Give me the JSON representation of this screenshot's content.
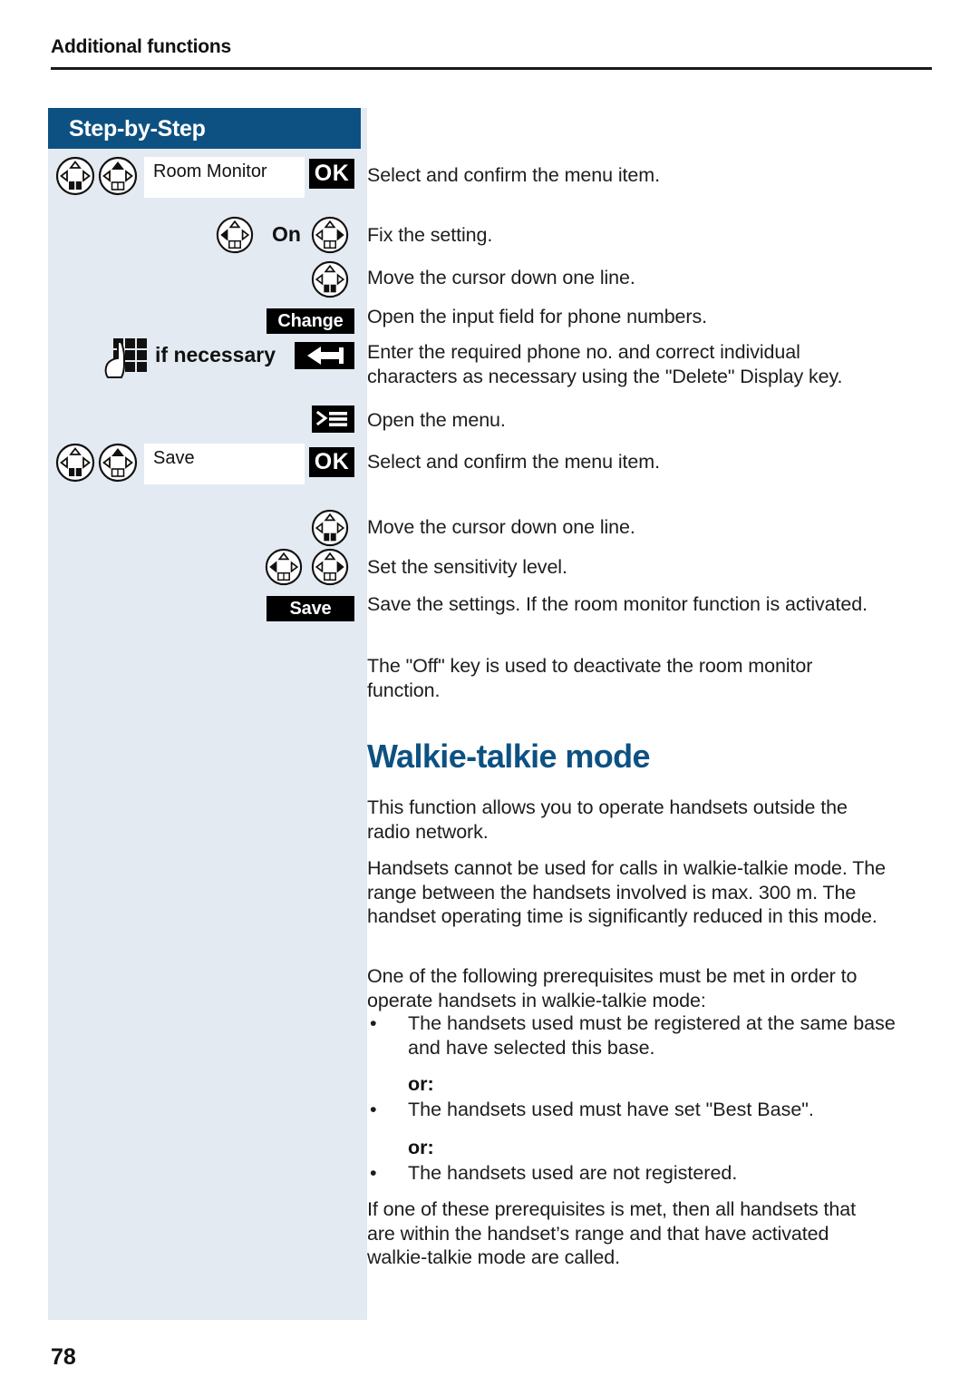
{
  "page": {
    "running_head": "Additional functions",
    "number": "78",
    "accent_color": "#0d5182",
    "panel_color": "#e4eaf1"
  },
  "step_panel": {
    "header": "Step-by-Step",
    "rows": [
      {
        "id": "room-monitor",
        "icons": [
          "nav-key-down-filled-book",
          "nav-key-up-filled"
        ],
        "display_value": "Room Monitor",
        "softkey": "OK"
      },
      {
        "id": "on-setting",
        "icons": [
          "nav-key-left-filled"
        ],
        "label": "On",
        "icons_right": [
          "nav-key-right-filled"
        ]
      },
      {
        "id": "cursor-down-1",
        "icons": [
          "nav-key-down-filled-book"
        ]
      },
      {
        "id": "open-number-field",
        "softkey": "Change"
      },
      {
        "id": "enter-number",
        "icons": [
          "keypad-hand-icon"
        ],
        "label": "if necessary",
        "softkey": "←"
      },
      {
        "id": "open-menu",
        "icons": [
          "menu-key-icon"
        ]
      },
      {
        "id": "save-menu-item",
        "icons": [
          "nav-key-down-filled-book",
          "nav-key-up-filled"
        ],
        "display_value": "Save",
        "softkey": "OK"
      },
      {
        "id": "cursor-down-2",
        "icons": [
          "nav-key-down-filled-book"
        ]
      },
      {
        "id": "sensitivity",
        "icons": [
          "nav-key-left-filled",
          "nav-key-right-filled"
        ]
      },
      {
        "id": "save-settings",
        "softkey": "Save"
      }
    ]
  },
  "instructions": [
    "Select and confirm the menu item.",
    "Fix the setting.",
    "Move the cursor down one line.",
    "Open the input field for phone numbers.",
    "Enter the required phone no. and correct individual characters as necessary using the \"Delete\" Display key.",
    "Open the menu.",
    "Select and confirm the menu item.",
    "Move the cursor down one line.",
    "Set the sensitivity level.",
    "Save the settings. If the room monitor function is activated.",
    "The \"Off\" key is used to deactivate the room monitor function."
  ],
  "section": {
    "heading": "Walkie-talkie mode",
    "paragraphs": [
      "This function allows you to operate handsets outside the radio network.",
      "Handsets cannot be used for calls in walkie-talkie mode. The range between the handsets involved is max. 300 m. The handset operating time is significantly reduced in this mode.",
      "One of the following prerequisites must be met in order to operate handsets in walkie-talkie mode:"
    ],
    "bullets": [
      "The handsets used must be registered at the same base and have selected this base.",
      "The handsets used must have set \"Best Base\".",
      "The handsets used are not registered."
    ],
    "or_labels": [
      "or:",
      "or:"
    ],
    "closing_paragraph": "If one of these prerequisites is met, then all handsets that are within the handset’s range and that have activated walkie-talkie mode are called."
  }
}
